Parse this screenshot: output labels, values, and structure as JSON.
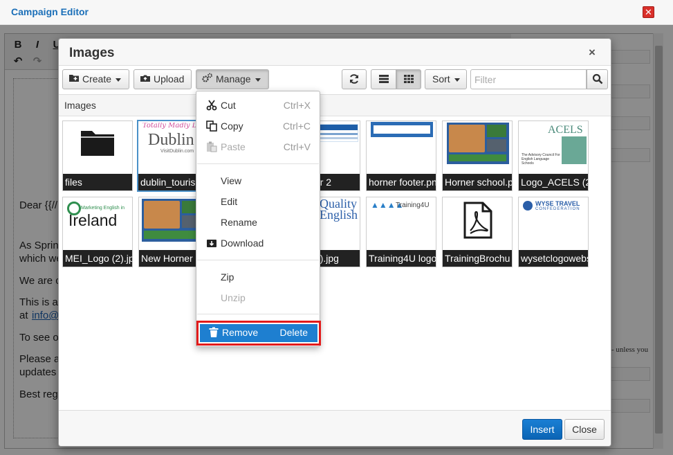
{
  "outer": {
    "title": "Campaign Editor",
    "close_icon": "close-x-icon"
  },
  "editor": {
    "toolbar": {
      "bold": "B",
      "italic": "I",
      "underline": "U"
    },
    "body_lines": [
      "Dear {{//F",
      "As Spring",
      "which we",
      "We are c",
      "This is ar",
      "at",
      "To see ou",
      "Please a",
      "updates c",
      "Best rega"
    ],
    "link_text": "info@t",
    "right_note": "- unless you"
  },
  "dialog": {
    "title": "Images",
    "close_symbol": "×",
    "toolbar": {
      "create": "Create",
      "upload": "Upload",
      "manage": "Manage",
      "sort": "Sort",
      "filter_placeholder": "Filter"
    },
    "path": "Images",
    "tiles": [
      {
        "caption": "files",
        "kind": "folder"
      },
      {
        "caption": "dublin_touris",
        "kind": "dublin",
        "thumb_text": "Dublin",
        "thumb_sub": "VisitDublin.com"
      },
      {
        "caption": "r footer 2",
        "kind": "footer"
      },
      {
        "caption": "horner footer.pn",
        "kind": "footer2"
      },
      {
        "caption": "Horner school.p",
        "kind": "photo"
      },
      {
        "caption": "Logo_ACELS (2",
        "kind": "acels",
        "thumb_text": "ACELS",
        "thumb_sub": "The Advisory Council For English Language Schools"
      },
      {
        "caption": "MEI_Logo (2).jp",
        "kind": "mei",
        "thumb_text": "Ireland",
        "thumb_sub": "Marketing English in"
      },
      {
        "caption": "New Horner S",
        "kind": "photo"
      },
      {
        "caption": "ogo (2).jpg",
        "kind": "quality",
        "thumb_text": "Quality",
        "thumb_sub": "English"
      },
      {
        "caption": "Training4U logo",
        "kind": "training",
        "thumb_text": "Training4U"
      },
      {
        "caption": "TrainingBrochu",
        "kind": "pdf"
      },
      {
        "caption": "wysetclogowebs",
        "kind": "wyse",
        "thumb_text": "WYSE TRAVEL",
        "thumb_sub": "CONFEDERATION"
      }
    ],
    "footer": {
      "insert": "Insert",
      "close": "Close"
    }
  },
  "context_menu": {
    "cut": {
      "label": "Cut",
      "shortcut": "Ctrl+X"
    },
    "copy": {
      "label": "Copy",
      "shortcut": "Ctrl+C"
    },
    "paste": {
      "label": "Paste",
      "shortcut": "Ctrl+V"
    },
    "view": "View",
    "edit": "Edit",
    "rename": "Rename",
    "download": "Download",
    "zip": "Zip",
    "unzip": "Unzip",
    "remove": {
      "label": "Remove",
      "shortcut": "Delete"
    }
  },
  "colors": {
    "accent": "#1e7fd0",
    "highlight_border": "#e21b1b",
    "title_blue": "#1b6fb8"
  }
}
